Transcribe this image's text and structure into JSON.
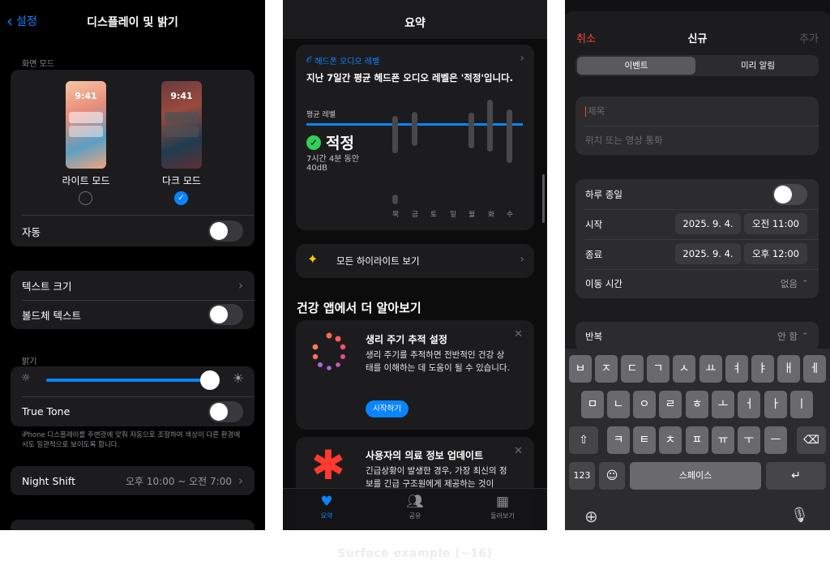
{
  "caption": "Surface example (~16)",
  "display_settings": {
    "back_label": "설정",
    "title": "디스플레이 및 밝기",
    "appearance_label": "화면 모드",
    "preview_time": "9:41",
    "light_label": "라이트 모드",
    "dark_label": "다크 모드",
    "auto_label": "자동",
    "text_size_label": "텍스트 크기",
    "bold_text_label": "볼드체 텍스트",
    "brightness_label": "밝기",
    "brightness_level": 0.95,
    "true_tone_label": "True Tone",
    "true_tone_note": "iPhone 디스플레이를 주변광에 맞춰 자동으로 조정하여 색상이 다른 환경에서도 일관적으로 보이도록 합니다.",
    "night_shift_label": "Night Shift",
    "night_shift_value": "오후 10:00 ~ 오전 7:00",
    "colors": {
      "accent": "#0a84ff",
      "toggle_off": "#39393d"
    }
  },
  "health": {
    "title": "요약",
    "card_header": "헤드폰 오디오 레벨",
    "card_summary": "지난 7일간 평균 헤드폰 오디오 레벨은 '적정'입니다.",
    "avg_label": "평균 레벨",
    "status": "적정",
    "duration": "7시간 4분 동안",
    "level": "40dB",
    "days": [
      "목",
      "금",
      "토",
      "일",
      "월",
      "화",
      "수"
    ],
    "highlights_label": "모든 하이라이트 보기",
    "section_title": "건강 앱에서 더 알아보기",
    "cycle_title": "생리 주기 추적 설정",
    "cycle_body": "생리 주기를 추적하면 전반적인 건강 상태를 이해하는 데 도움이 될 수 있습니다.",
    "cycle_button": "시작하기",
    "medical_title": "사용자의 의료 정보 업데이트",
    "medical_body": "긴급상황이 발생한 경우, 가장 최신의 정보를 긴급 구조원에게 제공하는 것이",
    "tabs": [
      "요약",
      "공유",
      "둘러보기"
    ],
    "colors": {
      "accent": "#0a84ff",
      "ok": "#30d158",
      "medical": "#ff3b30"
    }
  },
  "calendar": {
    "cancel_label": "취소",
    "title": "신규",
    "add_label": "추가",
    "segments": [
      "이벤트",
      "미리 알림"
    ],
    "title_placeholder": "제목",
    "location_placeholder": "위치 또는 영상 통화",
    "all_day_label": "하루 종일",
    "start_label": "시작",
    "start_date": "2025. 9. 4.",
    "start_time": "오전 11:00",
    "end_label": "종료",
    "end_date": "2025. 9. 4.",
    "end_time": "오후 12:00",
    "travel_label": "이동 시간",
    "travel_value": "없음",
    "repeat_label": "반복",
    "repeat_value": "안 함",
    "keyboard": {
      "row1": [
        "ㅂ",
        "ㅈ",
        "ㄷ",
        "ㄱ",
        "ㅅ",
        "ㅛ",
        "ㅕ",
        "ㅑ",
        "ㅐ",
        "ㅔ"
      ],
      "row2": [
        "ㅁ",
        "ㄴ",
        "ㅇ",
        "ㄹ",
        "ㅎ",
        "ㅗ",
        "ㅓ",
        "ㅏ",
        "ㅣ"
      ],
      "row3": [
        "ㅋ",
        "ㅌ",
        "ㅊ",
        "ㅍ",
        "ㅠ",
        "ㅜ",
        "ㅡ"
      ],
      "numbers_key": "123",
      "space_key": "스페이스"
    },
    "colors": {
      "cancel": "#ff453a"
    }
  }
}
